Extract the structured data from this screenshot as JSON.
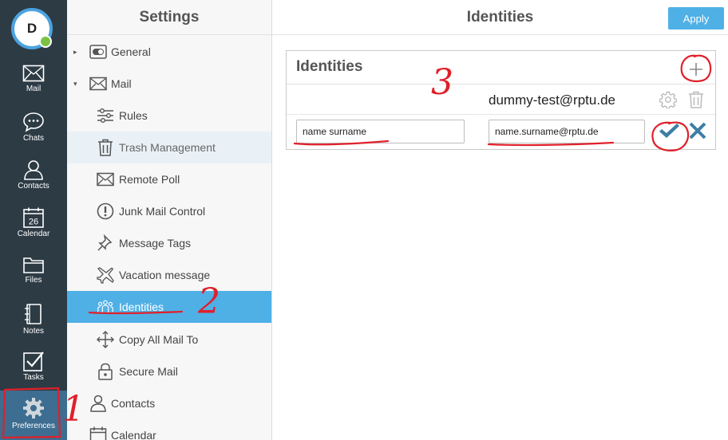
{
  "user": {
    "initial": "D"
  },
  "rail": [
    {
      "label": "Mail",
      "icon": "mail-icon"
    },
    {
      "label": "Chats",
      "icon": "chat-icon"
    },
    {
      "label": "Contacts",
      "icon": "contact-icon"
    },
    {
      "label": "Calendar",
      "icon": "calendar-icon",
      "day": "26"
    },
    {
      "label": "Files",
      "icon": "folder-icon"
    },
    {
      "label": "Notes",
      "icon": "notes-icon"
    },
    {
      "label": "Tasks",
      "icon": "tasks-icon"
    },
    {
      "label": "Preferences",
      "icon": "gear-icon",
      "active": true
    }
  ],
  "settings": {
    "title": "Settings",
    "items": [
      {
        "label": "General",
        "icon": "toggle-icon",
        "expander": "▸"
      },
      {
        "label": "Mail",
        "icon": "mail-icon",
        "expander": "▾"
      },
      {
        "label": "Rules",
        "icon": "sliders-icon"
      },
      {
        "label": "Trash Management",
        "icon": "trash-icon"
      },
      {
        "label": "Remote Poll",
        "icon": "envelope-icon"
      },
      {
        "label": "Junk Mail Control",
        "icon": "warning-icon"
      },
      {
        "label": "Message Tags",
        "icon": "pin-icon"
      },
      {
        "label": "Vacation message",
        "icon": "plane-icon"
      },
      {
        "label": "Identities",
        "icon": "people-icon"
      },
      {
        "label": "Copy All Mail To",
        "icon": "arrows-icon"
      },
      {
        "label": "Secure Mail",
        "icon": "lock-icon"
      },
      {
        "label": "Contacts",
        "icon": "contact-icon"
      },
      {
        "label": "Calendar",
        "icon": "calendar-icon"
      }
    ]
  },
  "main": {
    "title": "Identities",
    "apply_label": "Apply",
    "panel": {
      "title": "Identities",
      "existing_email": "dummy-test@rptu.de",
      "new_name": "name surname",
      "new_email": "name.surname@rptu.de"
    }
  },
  "annotations": {
    "step1": "1",
    "step2": "2",
    "step3": "3",
    "color": "#e0202a"
  },
  "colors": {
    "rail_bg": "#2d3b45",
    "accent": "#4fb0e6",
    "confirm": "#3d7ea6",
    "presence": "#7cc242"
  }
}
